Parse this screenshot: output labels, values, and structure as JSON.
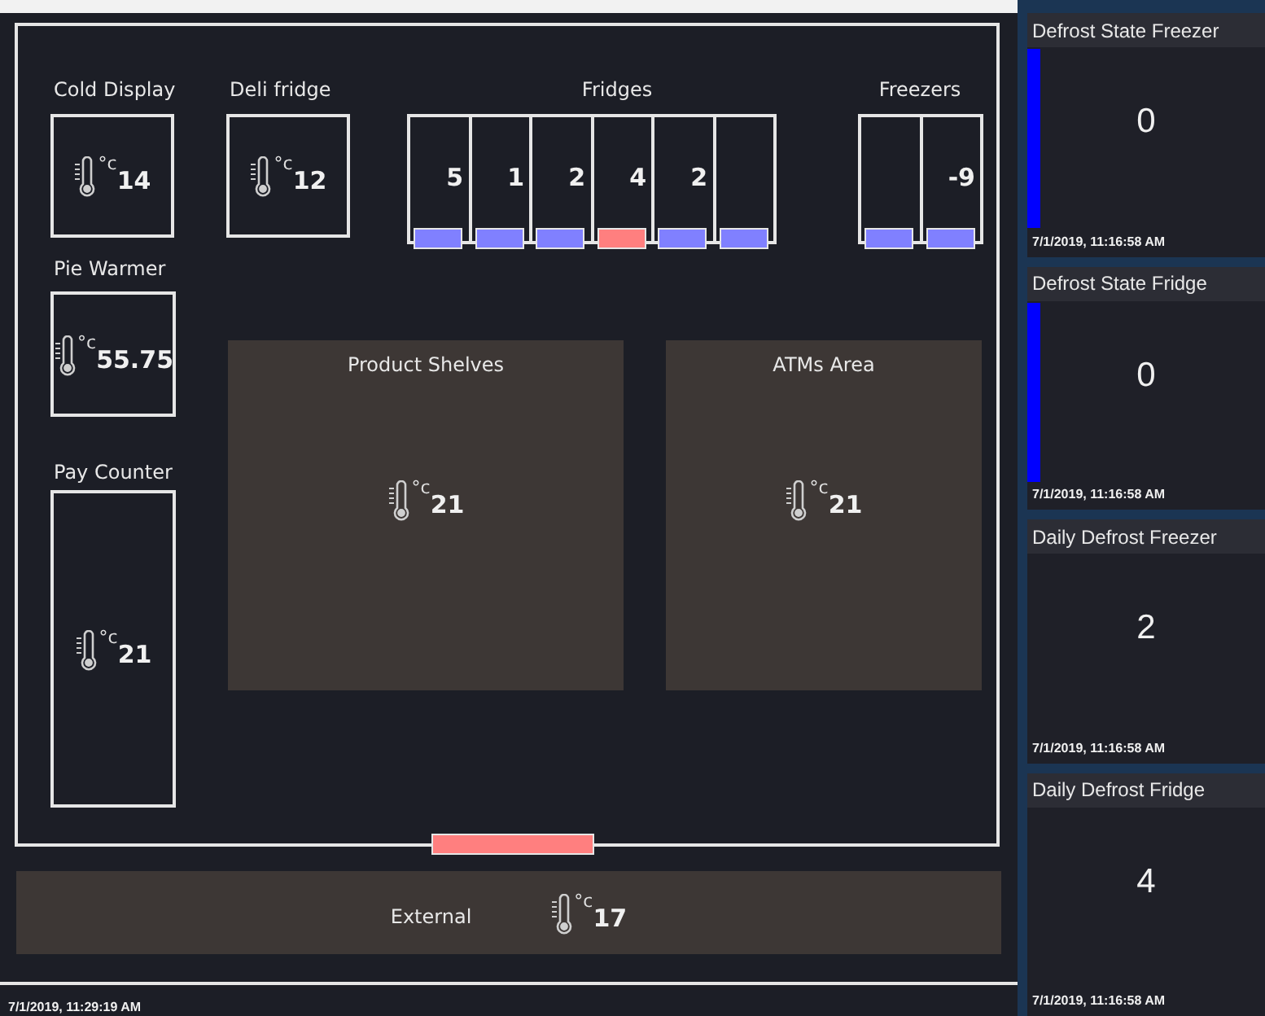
{
  "floor_plan": {
    "zones": [
      {
        "kind": "case",
        "label": "Cold Display",
        "unit": "°c",
        "reading": "14"
      },
      {
        "kind": "case",
        "label": "Deli fridge",
        "unit": "°c",
        "reading": "12"
      },
      {
        "kind": "case",
        "label": "Pie Warmer",
        "unit": "°c",
        "reading": "55.75"
      },
      {
        "kind": "case",
        "label": "Pay Counter",
        "unit": "°c",
        "reading": "21"
      },
      {
        "kind": "area",
        "label": "Product Shelves",
        "unit": "°c",
        "reading": "21"
      },
      {
        "kind": "area",
        "label": "ATMs Area",
        "unit": "°c",
        "reading": "21"
      }
    ],
    "fridges": {
      "label": "Fridges",
      "doors": [
        {
          "reading": "5",
          "color": "#8080ff"
        },
        {
          "reading": "1",
          "color": "#8080ff"
        },
        {
          "reading": "2",
          "color": "#8080ff"
        },
        {
          "reading": "4",
          "color": "#ff7f7f"
        },
        {
          "reading": "2",
          "color": "#8080ff"
        },
        {
          "color": "#8080ff"
        }
      ]
    },
    "freezers": {
      "label": "Freezers",
      "doors": [
        {
          "color": "#8080ff"
        },
        {
          "reading": "-9",
          "color": "#8080ff"
        }
      ]
    },
    "entrance": {
      "color": "#ff7f7f"
    },
    "external": {
      "label": "External",
      "unit": "°c",
      "reading": "17"
    },
    "updated": "7/1/2019, 11:29:19 AM"
  },
  "tiles": [
    {
      "kind": "bar",
      "title": "Defrost State Freezer",
      "value": "0",
      "time": "7/1/2019, 11:16:58 AM"
    },
    {
      "kind": "bar",
      "title": "Defrost State Fridge",
      "value": "0",
      "time": "7/1/2019, 11:16:58 AM"
    },
    {
      "kind": "plain",
      "title": "Daily Defrost Freezer",
      "value": "2",
      "time": "7/1/2019, 11:16:58 AM"
    },
    {
      "kind": "plain",
      "title": "Daily Defrost Fridge",
      "value": "4",
      "time": "7/1/2019, 11:16:58 AM"
    }
  ]
}
